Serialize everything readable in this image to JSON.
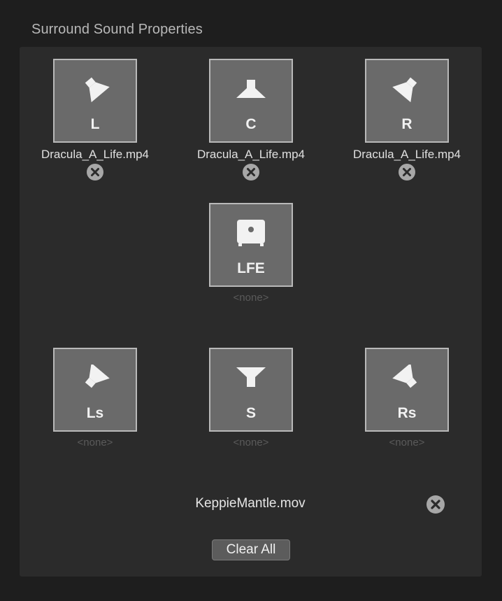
{
  "title": "Surround Sound Properties",
  "channels": {
    "L": {
      "label": "L",
      "file": "Dracula_A_Life.mp4",
      "icon": "speaker-front-left-icon"
    },
    "C": {
      "label": "C",
      "file": "Dracula_A_Life.mp4",
      "icon": "speaker-center-icon"
    },
    "R": {
      "label": "R",
      "file": "Dracula_A_Life.mp4",
      "icon": "speaker-front-right-icon"
    },
    "LFE": {
      "label": "LFE",
      "file": "<none>",
      "icon": "subwoofer-icon"
    },
    "Ls": {
      "label": "Ls",
      "file": "<none>",
      "icon": "speaker-surround-left-icon"
    },
    "S": {
      "label": "S",
      "file": "<none>",
      "icon": "speaker-surround-icon"
    },
    "Rs": {
      "label": "Rs",
      "file": "<none>",
      "icon": "speaker-surround-right-icon"
    }
  },
  "source_file": "KeppieMantle.mov",
  "clear_all_label": "Clear All"
}
